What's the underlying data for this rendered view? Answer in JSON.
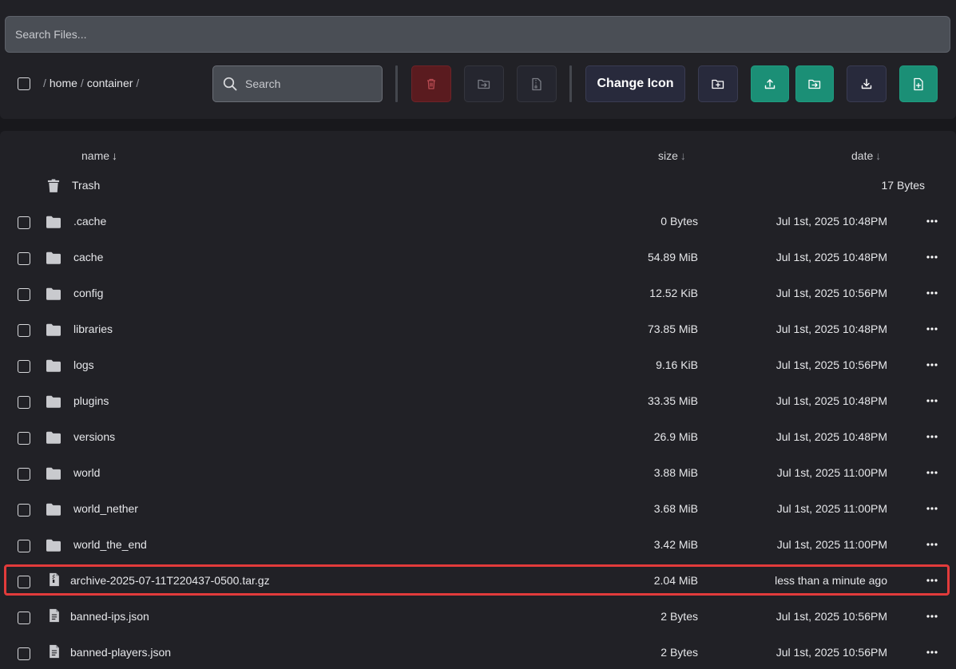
{
  "search_files": {
    "placeholder": "Search Files..."
  },
  "breadcrumb": {
    "sep": "/",
    "segments": [
      "home",
      "container"
    ]
  },
  "toolbar": {
    "search_placeholder": "Search",
    "change_icon_label": "Change Icon",
    "buttons": {
      "delete": "trash-icon",
      "move": "folder-move-icon",
      "archive": "file-archive-icon",
      "new_folder": "folder-plus-icon",
      "upload": "upload-icon",
      "upload_folder": "folder-upload-icon",
      "download": "download-icon",
      "new_file": "file-plus-icon"
    }
  },
  "columns": {
    "name": "name",
    "size": "size",
    "date": "date",
    "sort_arrow": "↓"
  },
  "trash": {
    "name": "Trash",
    "size": "17 Bytes"
  },
  "rows": [
    {
      "name": ".cache",
      "size": "0 Bytes",
      "date": "Jul 1st, 2025 10:48PM",
      "type": "folder"
    },
    {
      "name": "cache",
      "size": "54.89 MiB",
      "date": "Jul 1st, 2025 10:48PM",
      "type": "folder"
    },
    {
      "name": "config",
      "size": "12.52 KiB",
      "date": "Jul 1st, 2025 10:56PM",
      "type": "folder"
    },
    {
      "name": "libraries",
      "size": "73.85 MiB",
      "date": "Jul 1st, 2025 10:48PM",
      "type": "folder"
    },
    {
      "name": "logs",
      "size": "9.16 KiB",
      "date": "Jul 1st, 2025 10:56PM",
      "type": "folder"
    },
    {
      "name": "plugins",
      "size": "33.35 MiB",
      "date": "Jul 1st, 2025 10:48PM",
      "type": "folder"
    },
    {
      "name": "versions",
      "size": "26.9 MiB",
      "date": "Jul 1st, 2025 10:48PM",
      "type": "folder"
    },
    {
      "name": "world",
      "size": "3.88 MiB",
      "date": "Jul 1st, 2025 11:00PM",
      "type": "folder"
    },
    {
      "name": "world_nether",
      "size": "3.68 MiB",
      "date": "Jul 1st, 2025 11:00PM",
      "type": "folder"
    },
    {
      "name": "world_the_end",
      "size": "3.42 MiB",
      "date": "Jul 1st, 2025 11:00PM",
      "type": "folder"
    },
    {
      "name": "archive-2025-07-11T220437-0500.tar.gz",
      "size": "2.04 MiB",
      "date": "less than a minute ago",
      "type": "archive"
    },
    {
      "name": "banned-ips.json",
      "size": "2 Bytes",
      "date": "Jul 1st, 2025 10:56PM",
      "type": "file"
    },
    {
      "name": "banned-players.json",
      "size": "2 Bytes",
      "date": "Jul 1st, 2025 10:56PM",
      "type": "file"
    }
  ],
  "colors": {
    "accent_green": "#1b8f76",
    "danger": "#5a1b1f",
    "highlight": "#e23b3b"
  }
}
